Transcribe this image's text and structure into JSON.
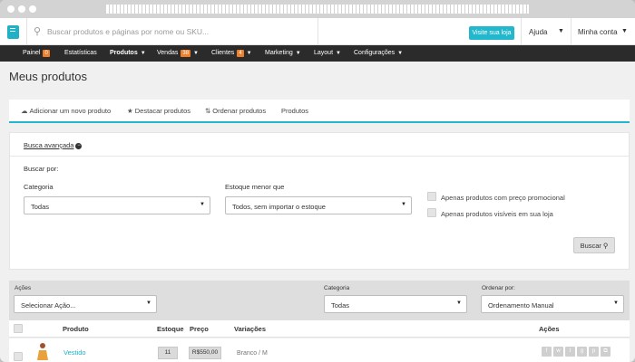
{
  "header": {
    "search_placeholder": "Buscar produtos e páginas por nome ou SKU...",
    "visit_store_label": "Visite sua loja",
    "help_label": "Ajuda",
    "account_label": "Minha conta"
  },
  "nav": {
    "items": [
      {
        "label": "Painel",
        "badge": "0"
      },
      {
        "label": "Estatísticas"
      },
      {
        "label": "Produtos"
      },
      {
        "label": "Vendas",
        "badge": "38"
      },
      {
        "label": "Clientes",
        "badge": "4"
      },
      {
        "label": "Marketing"
      },
      {
        "label": "Layout"
      },
      {
        "label": "Configurações"
      }
    ]
  },
  "page": {
    "title": "Meus produtos"
  },
  "tabs": [
    {
      "label": "Adicionar um novo produto",
      "icon": "cloud-upload-icon"
    },
    {
      "label": "Destacar produtos",
      "icon": "star-icon"
    },
    {
      "label": "Ordenar produtos",
      "icon": "sort-icon"
    },
    {
      "label": "Produtos"
    }
  ],
  "advanced_search": {
    "toggle_label": "Busca avançada",
    "search_by_label": "Buscar por:",
    "category_label": "Categoria",
    "category_value": "Todas",
    "stock_label": "Estoque menor que",
    "stock_value": "Todos, sem importar o estoque",
    "promo_label": "Apenas produtos com preço promocional",
    "visible_label": "Apenas produtos visíveis em sua loja",
    "search_button": "Buscar"
  },
  "filters": {
    "actions_label": "Ações",
    "actions_value": "Selecionar Ação...",
    "category_label": "Categoria",
    "category_value": "Todas",
    "order_label": "Ordenar por:",
    "order_value": "Ordenamento Manual"
  },
  "table": {
    "columns": [
      "Produto",
      "Estoque",
      "Preço",
      "Variações",
      "Ações"
    ],
    "rows": [
      {
        "name": "Vestido",
        "stock": "11",
        "price": "R$550,00",
        "variation": "Branco / M"
      }
    ]
  },
  "colors": {
    "accent": "#22b7cc",
    "badge": "#f07f2a",
    "navbar": "#2b2b2b"
  }
}
